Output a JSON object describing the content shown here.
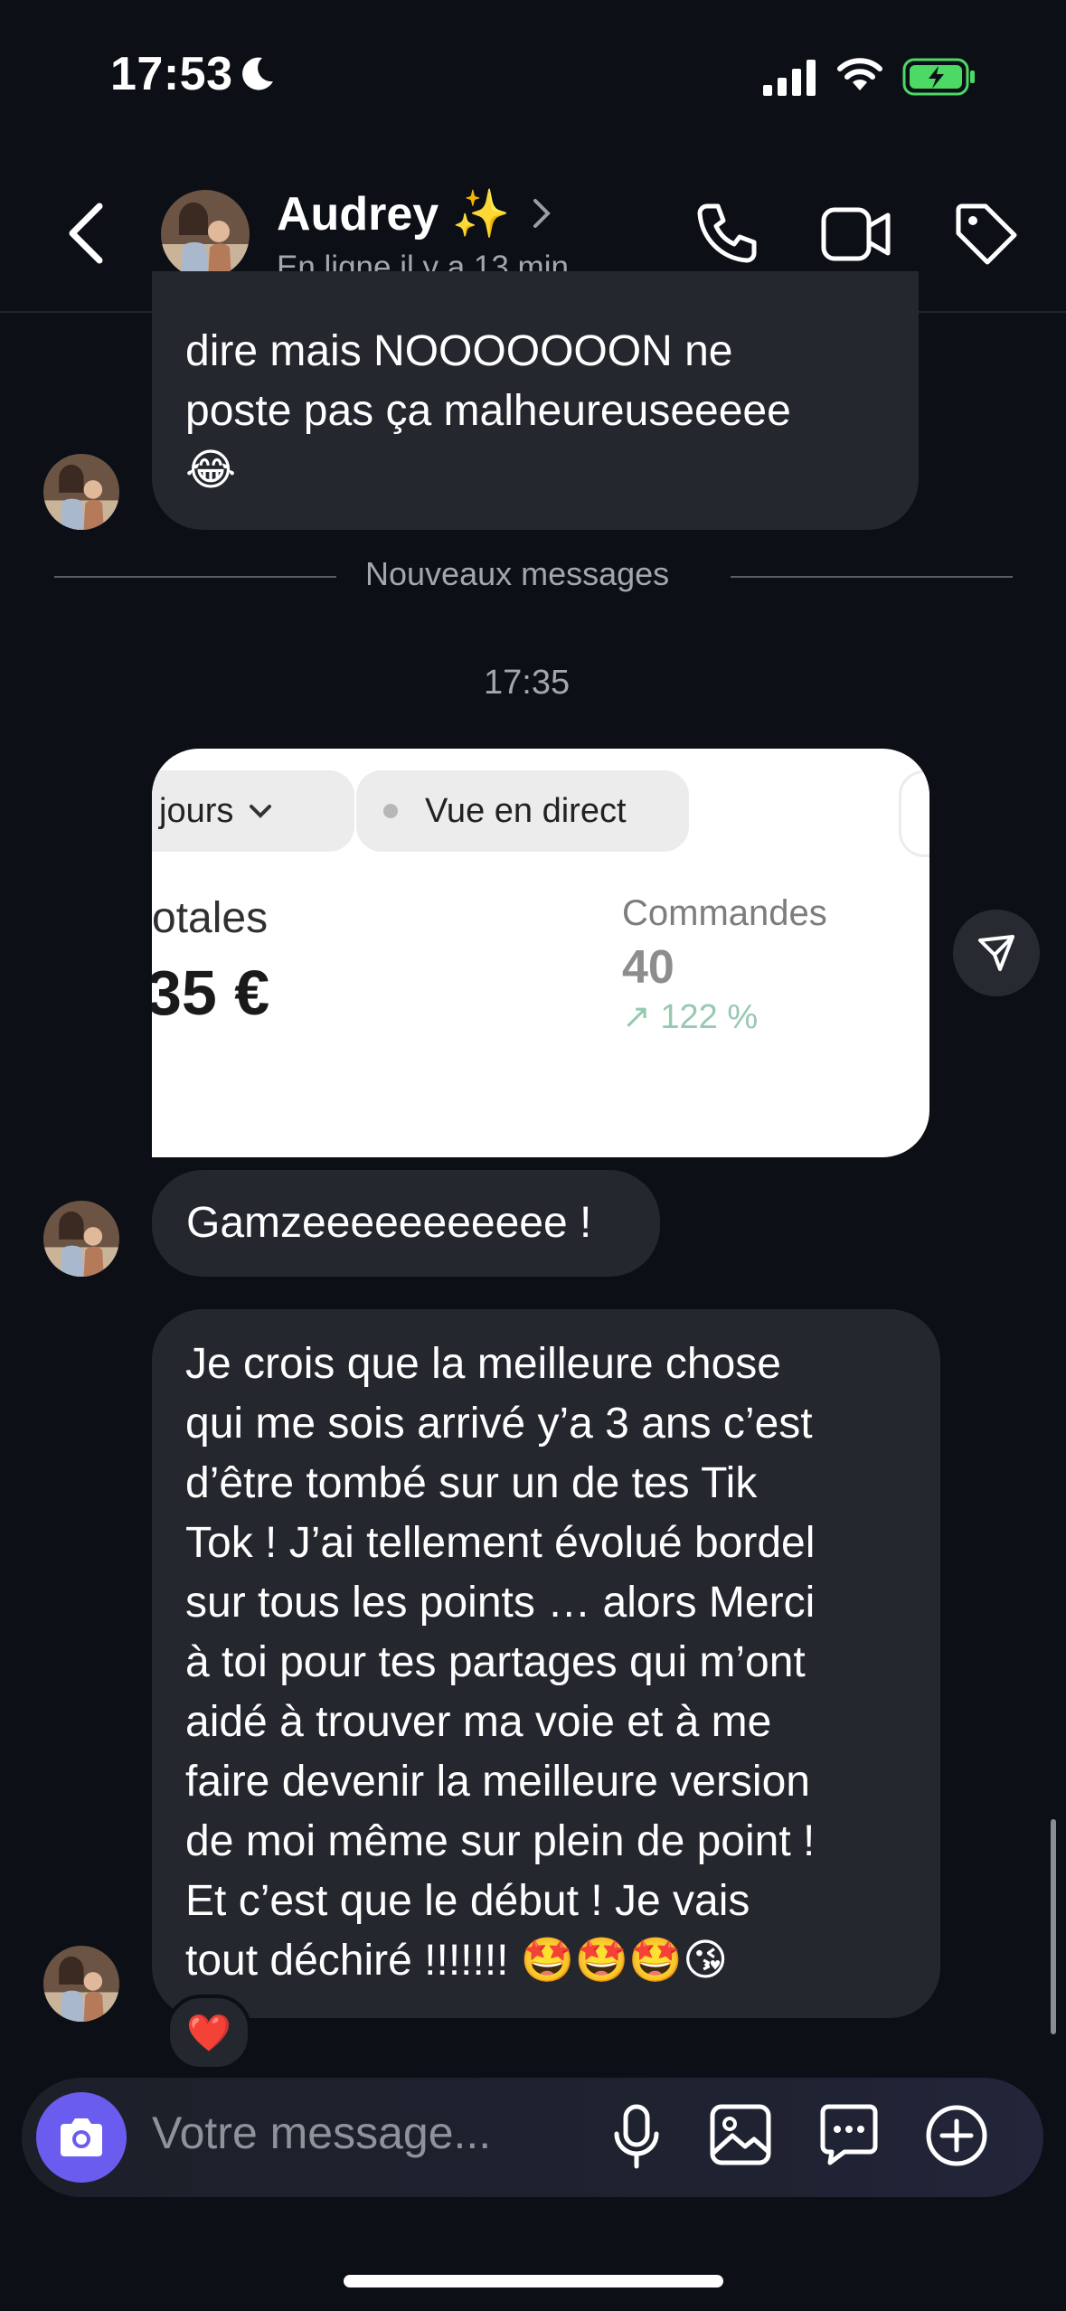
{
  "status_bar": {
    "time": "17:53"
  },
  "header": {
    "name": "Audrey ✨",
    "status": "En ligne il y a 13 min"
  },
  "messages": {
    "top_bubble_lines": [
      "dire mais NOOOOOOON ne",
      "poste pas ça malheureuseeeee",
      "😂"
    ],
    "new_messages_divider": "Nouveaux messages",
    "timestamp": "17:35",
    "shared_card": {
      "chip_period": "jours",
      "chip_live": "Vue en direct",
      "label_total": "otales",
      "value_total": "35 €",
      "label_orders": "Commandes",
      "value_orders": "40",
      "change_orders": "↗ 122 %"
    },
    "short_bubble": "Gamzeeeeeeeeeee !",
    "long_bubble_lines": [
      "Je crois que la meilleure chose",
      "qui me sois arrivé y’a 3 ans c’est",
      "d’être tombé sur un de tes Tik",
      "Tok ! J’ai tellement évolué bordel",
      "sur tous les points … alors Merci",
      "à toi pour tes partages qui m’ont",
      "aidé à trouver ma voie et à me",
      "faire devenir la meilleure version",
      "de moi même sur plein de point !",
      "Et c’est que le début ! Je vais",
      "tout déchiré !!!!!!! 🤩🤩🤩😘"
    ],
    "reaction": "❤️"
  },
  "composer": {
    "placeholder": "Votre message..."
  },
  "colors": {
    "accent": "#6b5cf0",
    "bubble": "#24272e",
    "background": "#0c1016",
    "battery": "#4cd964"
  },
  "icons": [
    "moon-icon",
    "signal-icon",
    "wifi-icon",
    "battery-icon",
    "back-icon",
    "chevron-right-icon",
    "phone-icon",
    "video-icon",
    "tag-icon",
    "chevron-down-icon",
    "share-icon",
    "camera-icon",
    "microphone-icon",
    "image-icon",
    "sticker-icon",
    "plus-icon"
  ]
}
